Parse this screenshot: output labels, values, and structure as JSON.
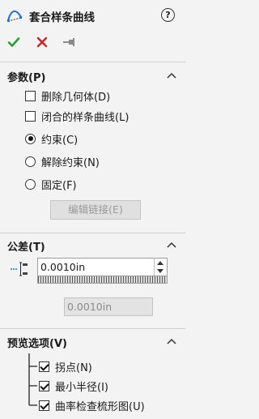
{
  "header": {
    "title": "套合样条曲线",
    "help": "?"
  },
  "actions": {
    "ok": "ok-check-icon",
    "cancel": "cancel-x-icon",
    "pin": "pin-icon"
  },
  "params": {
    "title": "参数(P)",
    "delete_geometry": {
      "label": "删除几何体(D)",
      "checked": false
    },
    "closed_spline": {
      "label": "闭合的样条曲线(L)",
      "checked": false
    },
    "constraint_options": [
      {
        "label": "约束(C)",
        "selected": true
      },
      {
        "label": "解除约束(N)",
        "selected": false
      },
      {
        "label": "固定(F)",
        "selected": false
      }
    ],
    "edit_link_button": "编辑链接(E)"
  },
  "tolerance": {
    "title": "公差(T)",
    "value": "0.0010in",
    "result": "0.0010in"
  },
  "preview": {
    "title": "预览选项(V)",
    "options": [
      {
        "label": "拐点(N)",
        "checked": true
      },
      {
        "label": "最小半径(I)",
        "checked": true
      },
      {
        "label": "曲率检查梳形图(U)",
        "checked": true
      }
    ]
  },
  "colors": {
    "accent_blue": "#1e6fd9",
    "ok_green": "#2a9d2a",
    "cancel_red": "#d32020"
  }
}
